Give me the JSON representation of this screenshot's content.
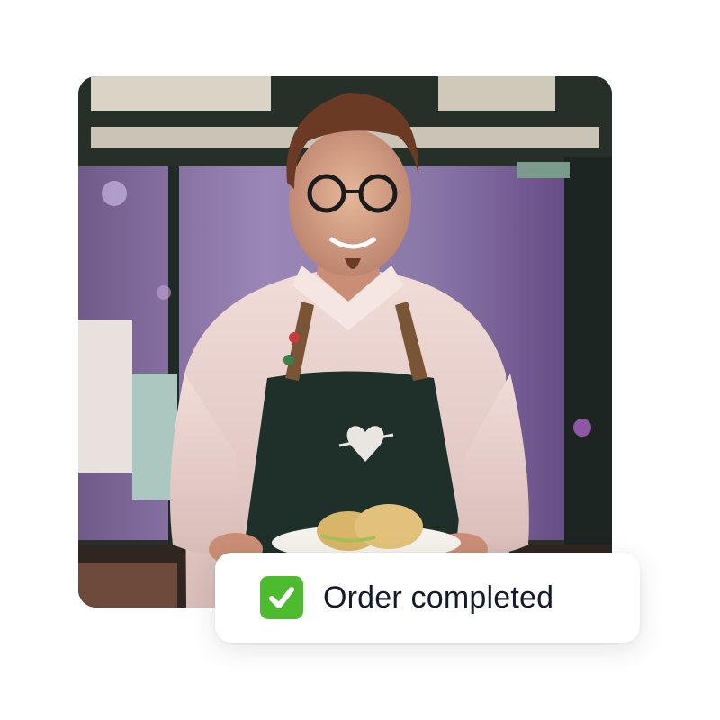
{
  "photo": {
    "subject": "barista-holding-sandwich"
  },
  "toast": {
    "icon": "check-mark-icon",
    "label": "Order completed",
    "accent_color": "#4cbb2e"
  }
}
